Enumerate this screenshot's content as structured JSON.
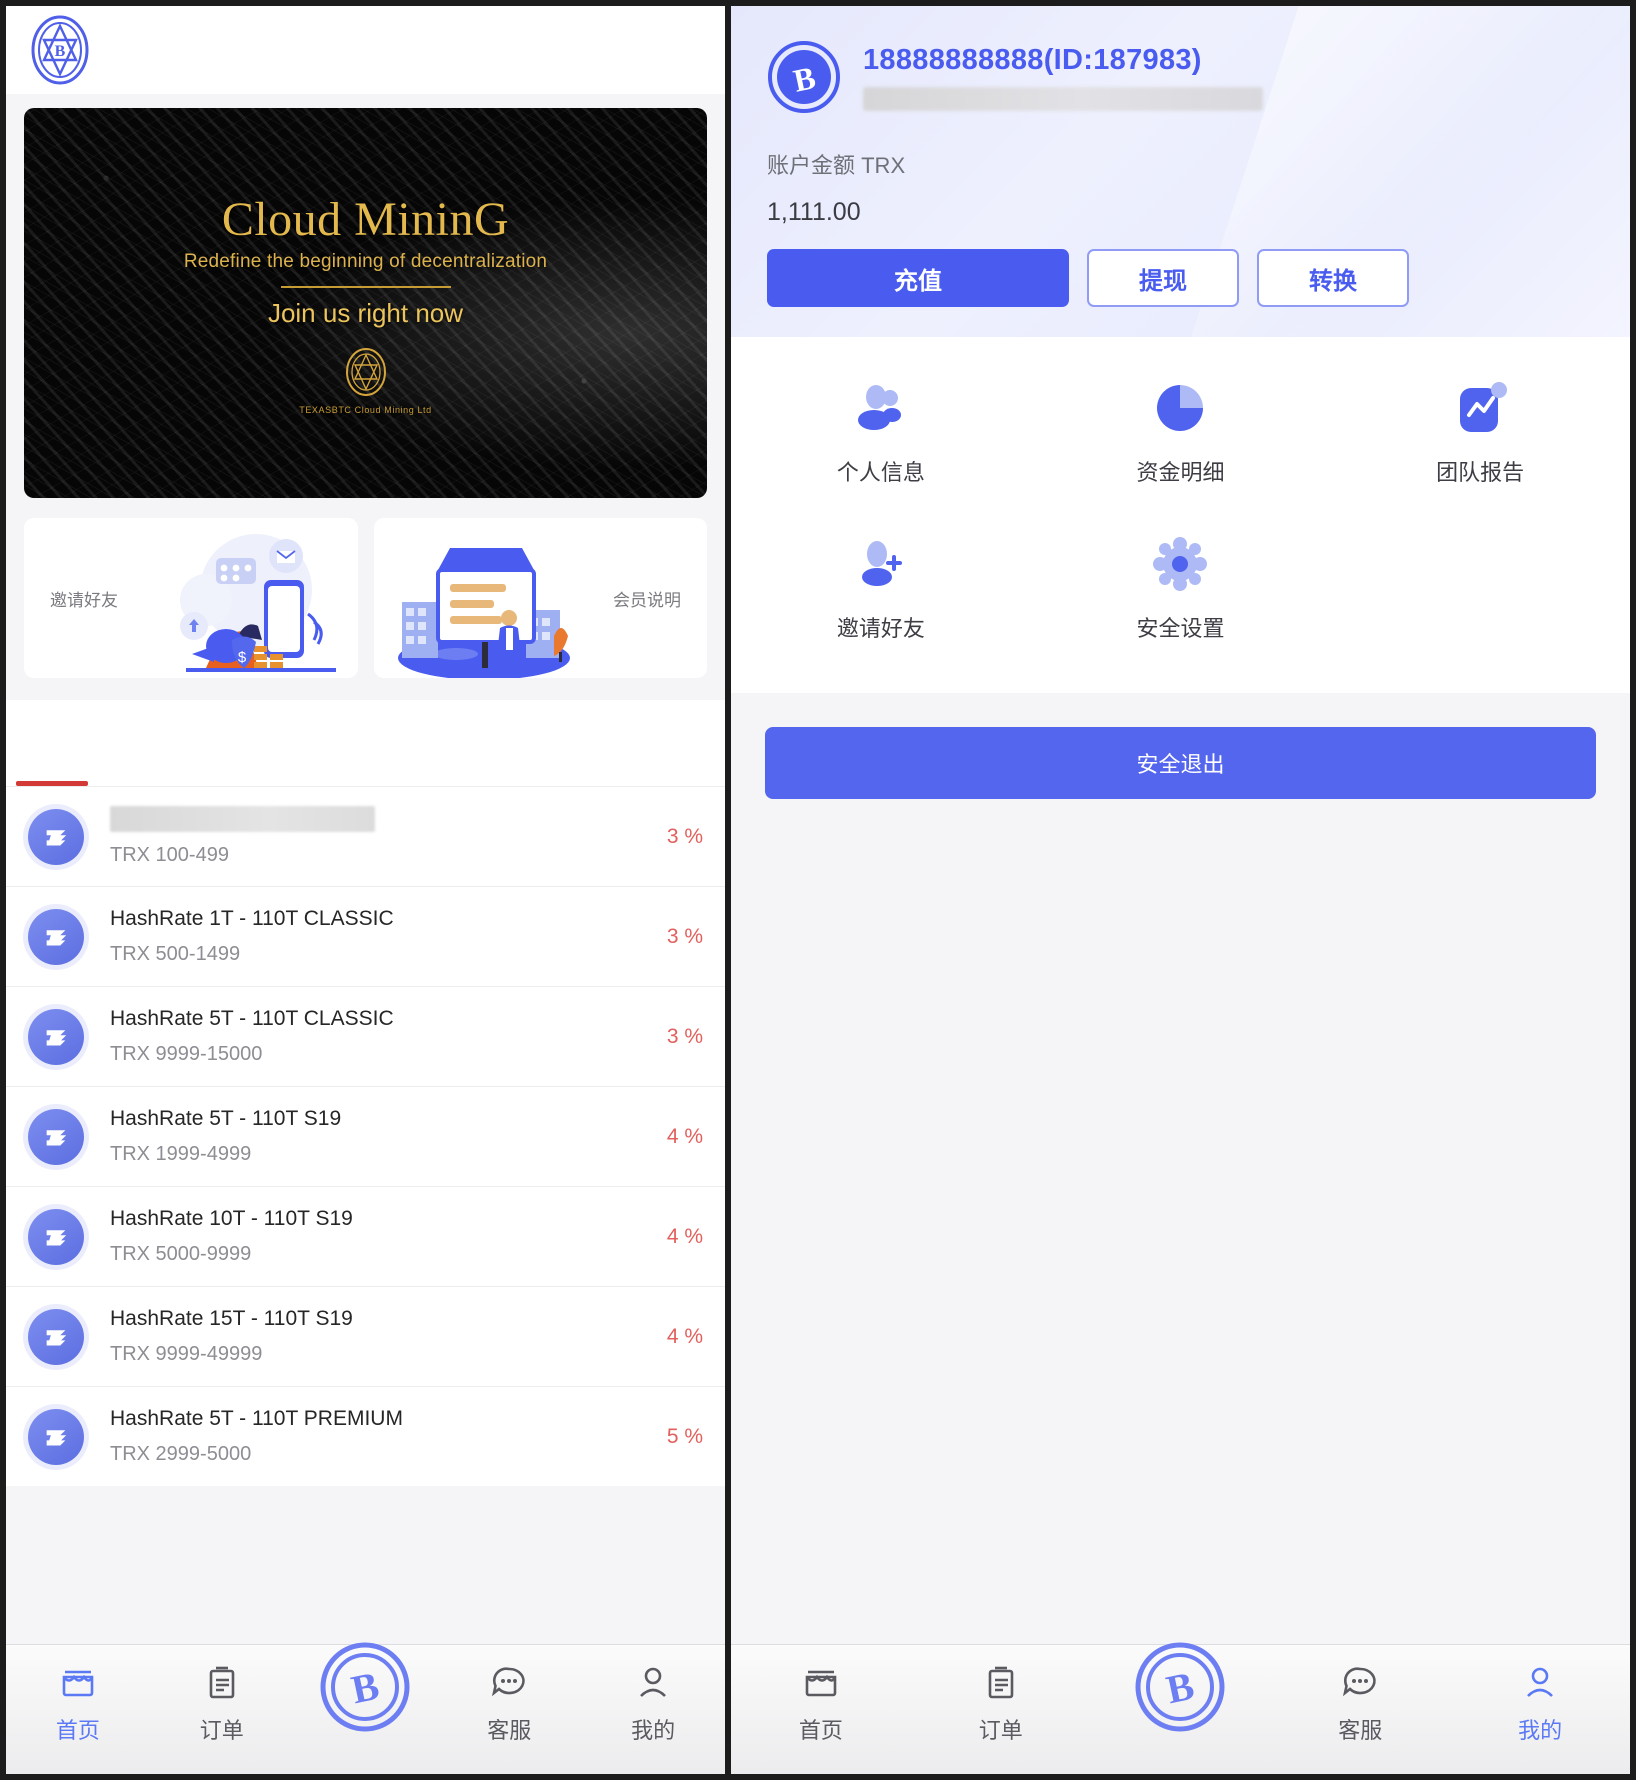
{
  "left_screen": {
    "brand_logo": "app-logo-icon",
    "banner": {
      "title": "Cloud MininG",
      "subtitle": "Redefine the beginning of decentralization",
      "cta": "Join us right now",
      "company": "TEXASBTC Cloud Mining Ltd"
    },
    "promos": [
      {
        "label": "邀请好友",
        "art": "invite-friends-illustration"
      },
      {
        "label": "会员说明",
        "art": "membership-info-illustration"
      }
    ],
    "products": [
      {
        "title": "",
        "title_redacted": true,
        "range": "TRX 100-499",
        "rate": "3 %"
      },
      {
        "title": "HashRate 1T - 110T CLASSIC",
        "title_redacted": false,
        "range": "TRX 500-1499",
        "rate": "3 %"
      },
      {
        "title": "HashRate 5T - 110T CLASSIC",
        "title_redacted": false,
        "range": "TRX 9999-15000",
        "rate": "3 %"
      },
      {
        "title": "HashRate 5T - 110T S19",
        "title_redacted": false,
        "range": "TRX 1999-4999",
        "rate": "4 %"
      },
      {
        "title": "HashRate 10T - 110T S19",
        "title_redacted": false,
        "range": "TRX 5000-9999",
        "rate": "4 %"
      },
      {
        "title": "HashRate 15T - 110T S19",
        "title_redacted": false,
        "range": "TRX 9999-49999",
        "rate": "4 %"
      },
      {
        "title": "HashRate 5T - 110T PREMIUM",
        "title_redacted": false,
        "range": "TRX 2999-5000",
        "rate": "5 %"
      }
    ],
    "tabbar": {
      "active": "首页",
      "items": [
        {
          "label": "首页",
          "icon": "storefront-icon"
        },
        {
          "label": "订单",
          "icon": "clipboard-icon"
        },
        {
          "label": "",
          "icon": "bitcoin-coin-icon"
        },
        {
          "label": "客服",
          "icon": "chat-bubble-icon"
        },
        {
          "label": "我的",
          "icon": "person-icon"
        }
      ]
    }
  },
  "right_screen": {
    "account": {
      "avatar_icon": "bitcoin-avatar-icon",
      "id_line": "18888888888(ID:187983)",
      "masked_line": "",
      "balance_label": "账户金额 TRX",
      "balance_value": "1,111.00",
      "actions": [
        {
          "label": "充值",
          "style": "primary"
        },
        {
          "label": "提现",
          "style": "ghost"
        },
        {
          "label": "转换",
          "style": "ghost"
        }
      ]
    },
    "menu": [
      {
        "label": "个人信息",
        "icon": "users-icon"
      },
      {
        "label": "资金明细",
        "icon": "pie-chart-icon"
      },
      {
        "label": "团队报告",
        "icon": "trend-report-icon"
      },
      {
        "label": "邀请好友",
        "icon": "user-plus-icon"
      },
      {
        "label": "安全设置",
        "icon": "gear-icon"
      }
    ],
    "logout_label": "安全退出",
    "tabbar": {
      "active": "我的",
      "items": [
        {
          "label": "首页",
          "icon": "storefront-icon"
        },
        {
          "label": "订单",
          "icon": "clipboard-icon"
        },
        {
          "label": "",
          "icon": "bitcoin-coin-icon"
        },
        {
          "label": "客服",
          "icon": "chat-bubble-icon"
        },
        {
          "label": "我的",
          "icon": "person-icon"
        }
      ]
    }
  },
  "colors": {
    "accent_blue": "#4a5cf0",
    "tab_active": "#5b79f5",
    "rate_red": "#e2605c",
    "tab_indicator_red": "#d33a35",
    "banner_gold": "#e3b94d"
  }
}
